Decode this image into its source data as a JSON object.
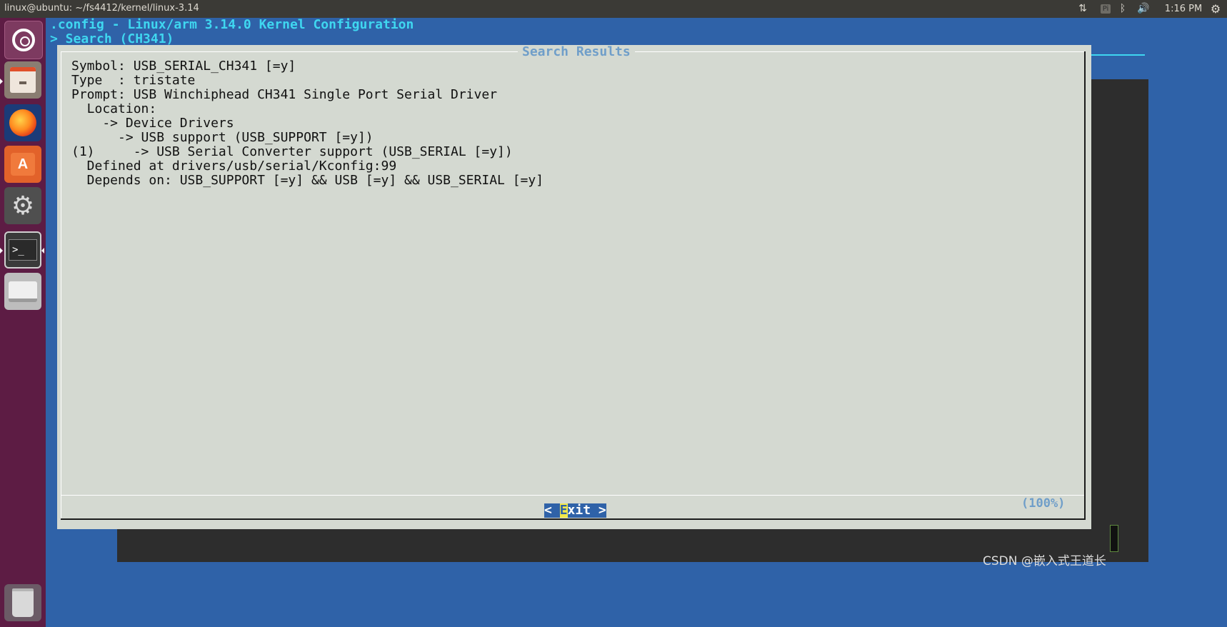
{
  "top_panel": {
    "window_title": "linux@ubuntu: ~/fs4412/kernel/linux-3.14",
    "keyboard_indicator": "Pi",
    "clock": "1:16 PM"
  },
  "launcher": {
    "items": [
      {
        "name": "ubuntu-dash",
        "icon": "ubuntu-logo-icon"
      },
      {
        "name": "files",
        "icon": "file-cabinet-icon"
      },
      {
        "name": "firefox",
        "icon": "firefox-icon"
      },
      {
        "name": "software-center",
        "icon": "shopping-bag-icon",
        "glyph": "A"
      },
      {
        "name": "system-settings",
        "icon": "gear-wrench-icon"
      },
      {
        "name": "terminal",
        "icon": "terminal-icon",
        "glyph": ">_"
      },
      {
        "name": "drive",
        "icon": "drive-icon"
      },
      {
        "name": "trash",
        "icon": "trash-icon"
      }
    ]
  },
  "terminal": {
    "menu_title": ".config - Linux/arm 3.14.0 Kernel Configuration",
    "breadcrumb": "> Search (CH341)",
    "dialog": {
      "title": "Search Results",
      "lines": [
        "Symbol: USB_SERIAL_CH341 [=y]",
        "Type  : tristate",
        "Prompt: USB Winchiphead CH341 Single Port Serial Driver",
        "  Location:",
        "    -> Device Drivers",
        "      -> USB support (USB_SUPPORT [=y])",
        "(1)     -> USB Serial Converter support (USB_SERIAL [=y])",
        "  Defined at drivers/usb/serial/Kconfig:99",
        "  Depends on: USB_SUPPORT [=y] && USB [=y] && USB_SERIAL [=y]"
      ],
      "scroll_percent": "(100%)",
      "exit_button": {
        "left": "< ",
        "hotkey": "E",
        "rest": "xit >"
      }
    }
  },
  "watermark": "CSDN @嵌入式王道长",
  "colors": {
    "terminal_bg": "#2f62a8",
    "title_text": "#3fd7f0",
    "dialog_bg": "#d4d9d1",
    "dialog_title": "#6f9ec9",
    "hotkey_bg": "#f2e84a",
    "launcher_bg": "#5d1c44"
  }
}
